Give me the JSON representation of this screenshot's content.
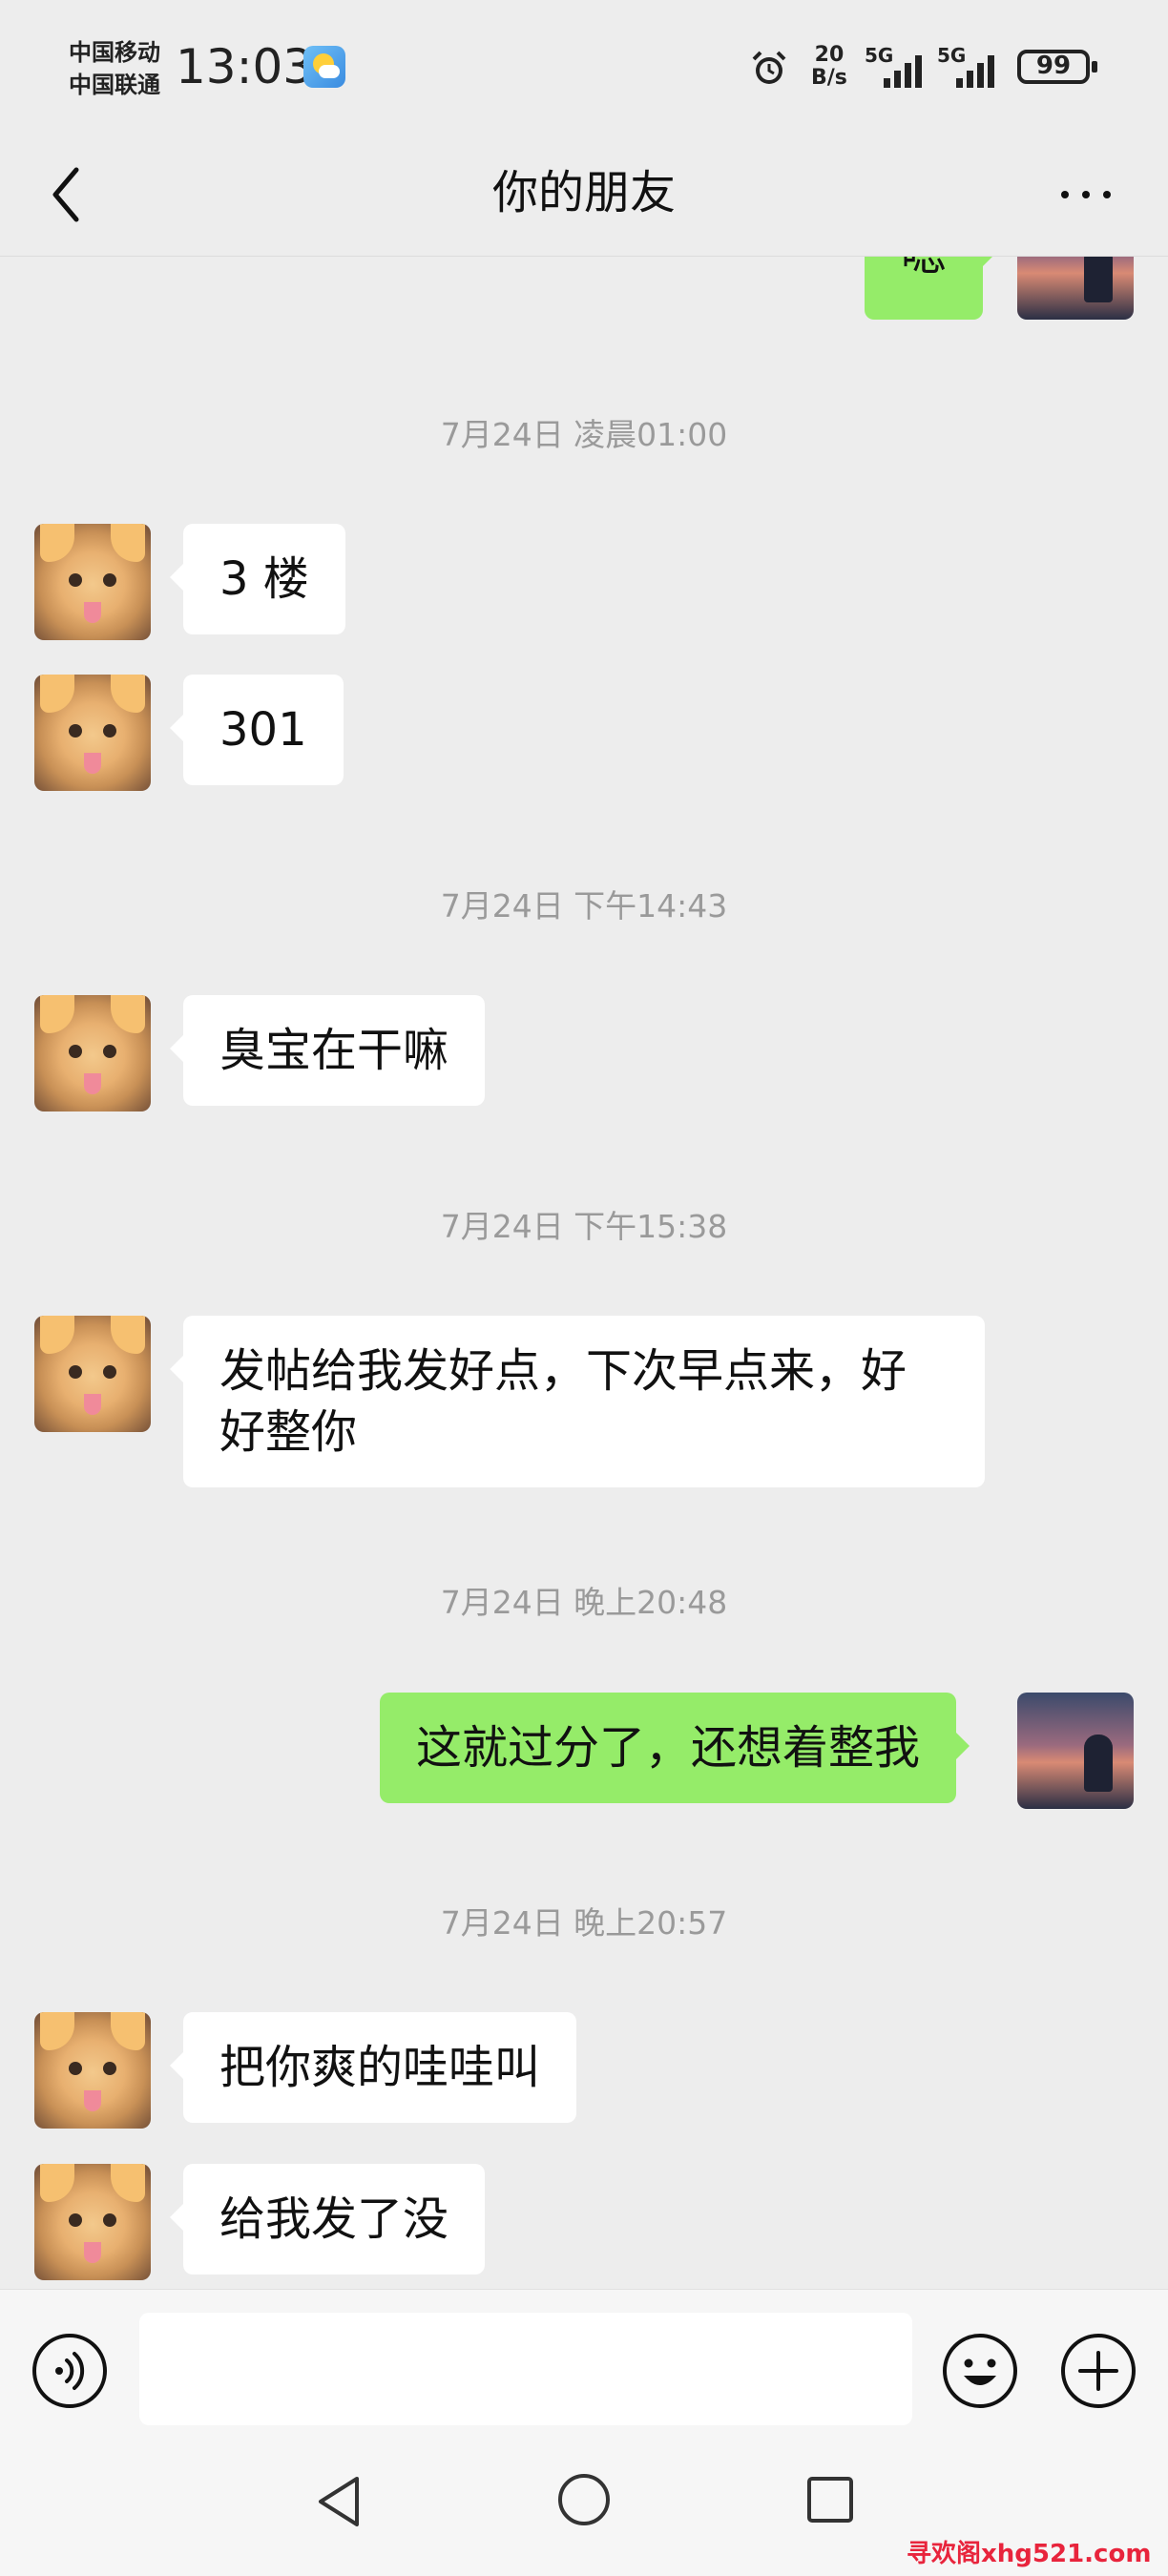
{
  "status_bar": {
    "carrier_1": "中国移动",
    "carrier_2": "中国联通",
    "time": "13:03",
    "net_speed_value": "20",
    "net_speed_unit": "B/s",
    "signal_1": "5G",
    "signal_2": "5G",
    "battery": "99",
    "icons": [
      "weather-icon",
      "alarm-icon",
      "signal-icon",
      "battery-icon"
    ]
  },
  "header": {
    "title": "你的朋友",
    "back_icon": "chevron-left-icon",
    "more_icon": "more-icon"
  },
  "messages": {
    "top_partial": "嗯",
    "ts1": "7月24日 凌晨01:00",
    "m1": "3 楼",
    "m2": "301",
    "ts2": "7月24日 下午14:43",
    "m3": "臭宝在干嘛",
    "ts3": "7月24日 下午15:38",
    "m4": "发帖给我发好点，下次早点来，好好整你",
    "ts4": "7月24日 晚上20:48",
    "m5": "这就过分了，还想着整我",
    "ts5": "7月24日 晚上20:57",
    "m6": "把你爽的哇哇叫",
    "m7": "给我发了没"
  },
  "input_bar": {
    "value": "",
    "icons": [
      "voice-icon",
      "emoji-icon",
      "plus-icon"
    ]
  },
  "system_nav": {
    "icons": [
      "nav-back-icon",
      "nav-home-icon",
      "nav-recent-icon"
    ]
  },
  "watermark": "寻欢阁xhg521.com",
  "colors": {
    "background": "#ededed",
    "sent_bubble": "#95ec69",
    "received_bubble": "#ffffff",
    "watermark": "#e8243c"
  }
}
